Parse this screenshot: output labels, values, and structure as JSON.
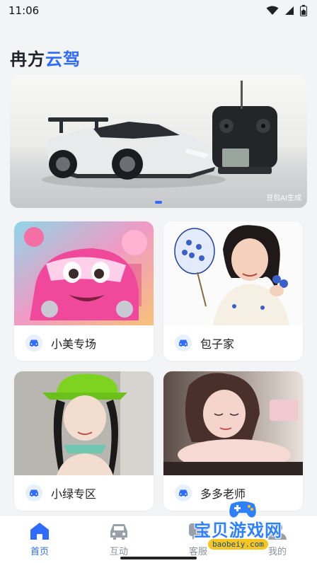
{
  "status_bar": {
    "time": "11:06"
  },
  "header": {
    "title_part1": "冉方",
    "title_part2": "云驾"
  },
  "banner": {
    "watermark": "豆包AI生成"
  },
  "cards": [
    {
      "name": "小美专场"
    },
    {
      "name": "包子家"
    },
    {
      "name": "小绿专区"
    },
    {
      "name": "多多老师"
    }
  ],
  "bottom_nav": [
    {
      "label": "首页",
      "icon": "home-icon",
      "active": true
    },
    {
      "label": "互动",
      "icon": "car-icon",
      "active": false
    },
    {
      "label": "客服",
      "icon": "chat-icon",
      "active": false
    },
    {
      "label": "我的",
      "icon": "user-icon",
      "active": false
    }
  ],
  "site_logo": {
    "text": "宝贝游戏网",
    "url": "baobeiy.com"
  },
  "colors": {
    "accent": "#2f6bff",
    "background": "#f3f4f6",
    "card": "#ffffff"
  }
}
